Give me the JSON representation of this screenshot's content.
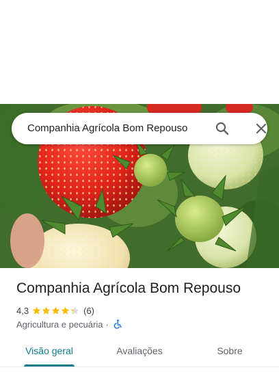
{
  "search": {
    "query": "Companhia Agrícola Bom Repouso",
    "search_icon": "search-icon",
    "close_icon": "close-icon"
  },
  "hero": {
    "image": "strawberries-photo"
  },
  "place": {
    "name": "Companhia Agrícola Bom Repouso",
    "rating": "4,3",
    "rating_fraction": 0.86,
    "review_count": "(6)",
    "category": "Agricultura e pecuária",
    "separator": "·",
    "accessibility_icon": "wheelchair-icon"
  },
  "colors": {
    "accent": "#0e7a8b",
    "star": "#fbbc04",
    "star_empty": "#dadce0"
  },
  "tabs": [
    {
      "label": "Visão geral",
      "active": true
    },
    {
      "label": "Avaliações",
      "active": false
    },
    {
      "label": "Sobre",
      "active": false
    }
  ]
}
